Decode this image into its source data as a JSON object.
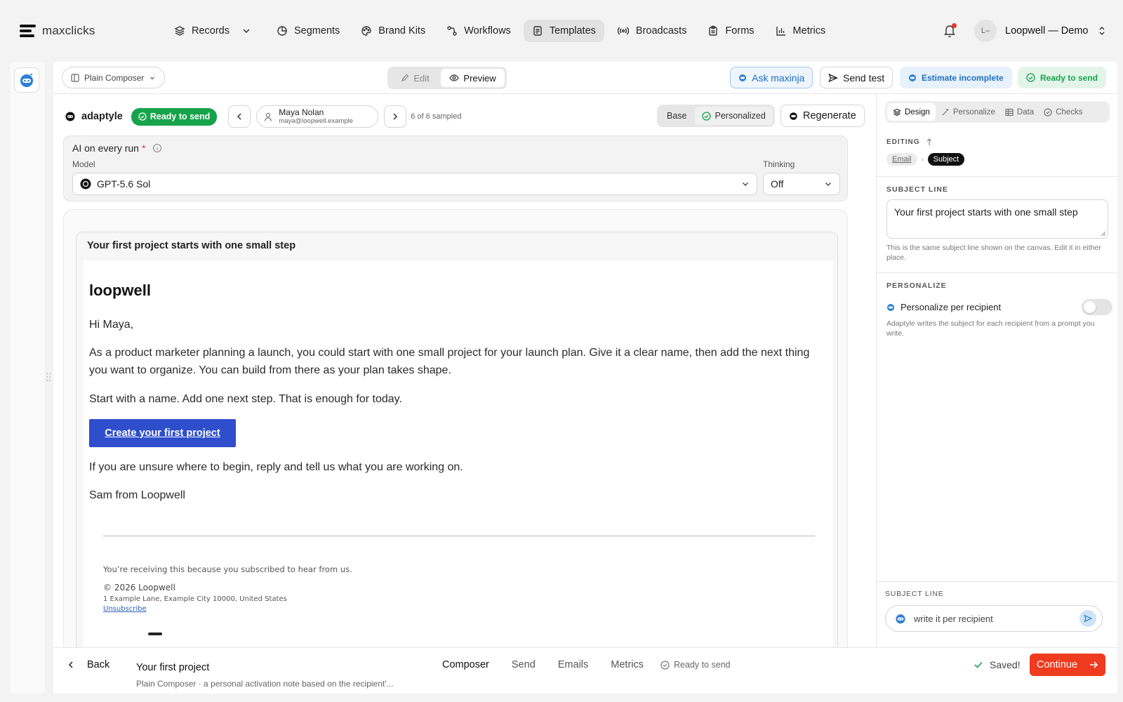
{
  "app": {
    "brand": "maxclicks"
  },
  "nav": [
    {
      "label": "Records",
      "icon": "layers-icon",
      "active": false,
      "chevron": true
    },
    {
      "label": "Segments",
      "icon": "pie-icon",
      "active": false
    },
    {
      "label": "Brand Kits",
      "icon": "palette-icon",
      "active": false
    },
    {
      "label": "Workflows",
      "icon": "workflow-icon",
      "active": false
    },
    {
      "label": "Templates",
      "icon": "document-icon",
      "active": true
    },
    {
      "label": "Broadcasts",
      "icon": "broadcast-icon",
      "active": false
    },
    {
      "label": "Forms",
      "icon": "clipboard-icon",
      "active": false
    },
    {
      "label": "Metrics",
      "icon": "bar-chart-icon",
      "active": false
    }
  ],
  "account": {
    "initials": "L–",
    "name": "Loopwell — Demo"
  },
  "toolbar": {
    "composer_label": "Plain Composer",
    "edit_label": "Edit",
    "preview_label": "Preview",
    "ask_label": "Ask maxinja",
    "send_test_label": "Send test",
    "estimate_label": "Estimate incomplete",
    "ready_label": "Ready to send"
  },
  "preview_bar": {
    "brand": "adaptyle",
    "status": "Ready to send",
    "recipient_name": "Maya Nolan",
    "recipient_email": "maya@loopwell.example",
    "sampled": "6 of 6 sampled",
    "base_label": "Base",
    "personalized_label": "Personalized",
    "regenerate_label": "Regenerate"
  },
  "ai_box": {
    "title": "AI on every run",
    "required": "*",
    "model_label": "Model",
    "model_value": "GPT-5.6 Sol",
    "thinking_label": "Thinking",
    "thinking_value": "Off"
  },
  "email": {
    "subject": "Your first project starts with one small step",
    "brand": "loopwell",
    "greeting": "Hi Maya,",
    "para1": "As a product marketer planning a launch, you could start with one small project for your launch plan. Give it a clear name, then add the next thing you want to organize. You can build from there as your plan takes shape.",
    "para2": "Start with a name. Add one next step. That is enough for today.",
    "cta": "Create your first project",
    "para3": "If you are unsure where to begin, reply and tell us what you are working on.",
    "signoff": "Sam from Loopwell",
    "footer_reason": "You’re receiving this because you subscribed to hear from us.",
    "copyright": "© 2026 Loopwell",
    "address": "1 Example Lane, Example City 10000, United States",
    "unsubscribe": "Unsubscribe",
    "colors": {
      "cta": "#2f4ecb"
    }
  },
  "right_panel": {
    "tabs": [
      "Design",
      "Personalize",
      "Data",
      "Checks"
    ],
    "editing_label": "EDITING",
    "crumb_email": "Email",
    "crumb_subject": "Subject",
    "subject_line_label": "SUBJECT LINE",
    "subject_value": "Your first project starts with one small step",
    "subject_note": "This is the same subject line shown on the canvas. Edit it in either place.",
    "personalize_label": "PERSONALIZE",
    "personalize_toggle_label": "Personalize per recipient",
    "personalize_on": false,
    "personalize_note": "Adaptyle writes the subject for each recipient from a prompt you write.",
    "prompt_label": "SUBJECT LINE",
    "prompt_value": "write it per recipient"
  },
  "footer": {
    "back_label": "Back",
    "title": "Your first project",
    "subtitle": "Plain Composer · a personal activation note based on the recipient'...",
    "tabs": [
      "Composer",
      "Send",
      "Emails",
      "Metrics"
    ],
    "active_tab": "Composer",
    "status": "Ready to send",
    "saved": "Saved!",
    "continue_label": "Continue"
  },
  "colors": {
    "green": "#16a34a",
    "orange": "#ef3b1f",
    "blue": "#2b7fd4",
    "notify": "#e8372b"
  }
}
